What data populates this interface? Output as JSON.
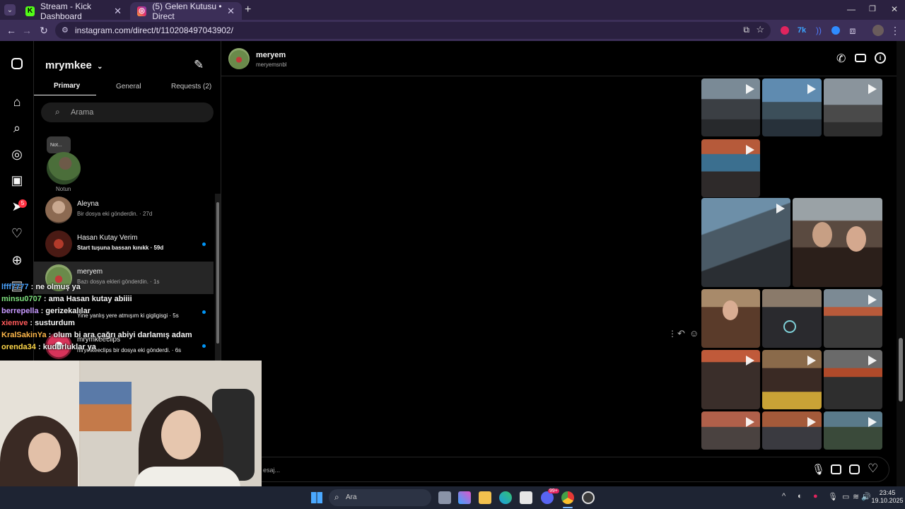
{
  "browser": {
    "tabs": [
      {
        "title": "Stream - Kick Dashboard",
        "favicon": "kick-icon",
        "active": false
      },
      {
        "title": "(5) Gelen Kutusu • Direct",
        "favicon": "instagram-icon",
        "active": true
      }
    ],
    "url": "instagram.com/direct/t/110208497043902/",
    "new_tab": "+"
  },
  "instagram": {
    "account": "mrymkee",
    "notification_badge": "5",
    "inbox_tabs": [
      "Primary",
      "General",
      "Requests (2)"
    ],
    "search_placeholder": "Arama",
    "note": {
      "bubble": "Not...",
      "label": "Notun"
    },
    "conversations": [
      {
        "name": "Aleyna",
        "preview": "Bir dosya eki gönderdin. · 27d",
        "unread": false
      },
      {
        "name": "Hasan Kutay Verim",
        "preview": "Start tuşuna bassan kınıkk · 59d",
        "unread": true
      },
      {
        "name": "meryem",
        "preview": "Bazı dosya ekleri gönderdin. · 1s",
        "unread": false,
        "selected": true
      },
      {
        "name": "",
        "preview": "Yine yanlış yere atmışım ki gigligisgi · 5s",
        "unread": true
      },
      {
        "name": "mrymkeeclips",
        "preview": "mrymkeeclips bir dosya eki gönderdi. · 6s",
        "unread": true
      }
    ],
    "chat": {
      "name": "meryem",
      "username": "meryemsnbl",
      "input_placeholder": "esaj..."
    }
  },
  "stream_chat": [
    {
      "user": "lfff7777",
      "msg": "ne olmuş ya",
      "color": "#4aa3ff"
    },
    {
      "user": "minsu0707",
      "msg": "ama Hasan kutay abiiii",
      "color": "#7fe07f"
    },
    {
      "user": "berrepella",
      "msg": "gerizekalılar",
      "color": "#c79aff"
    },
    {
      "user": "xiemve",
      "msg": "susturdum",
      "color": "#ff5a5a"
    },
    {
      "user": "KralSakinYa",
      "msg": "olum bi ara çağrı abiyi darlamış adam",
      "color": "#ffb84a"
    },
    {
      "user": "orenda34",
      "msg": "kudurluklar ya",
      "color": "#ffd84a"
    }
  ],
  "taskbar": {
    "search": "Ara",
    "time": "23:45",
    "date": "19.10.2025",
    "badge": "99+"
  },
  "colors": {
    "tabbar": "#2b2140",
    "toolbar": "#3c2f58",
    "ig_bg": "#000000",
    "unread_dot": "#0095f6"
  }
}
